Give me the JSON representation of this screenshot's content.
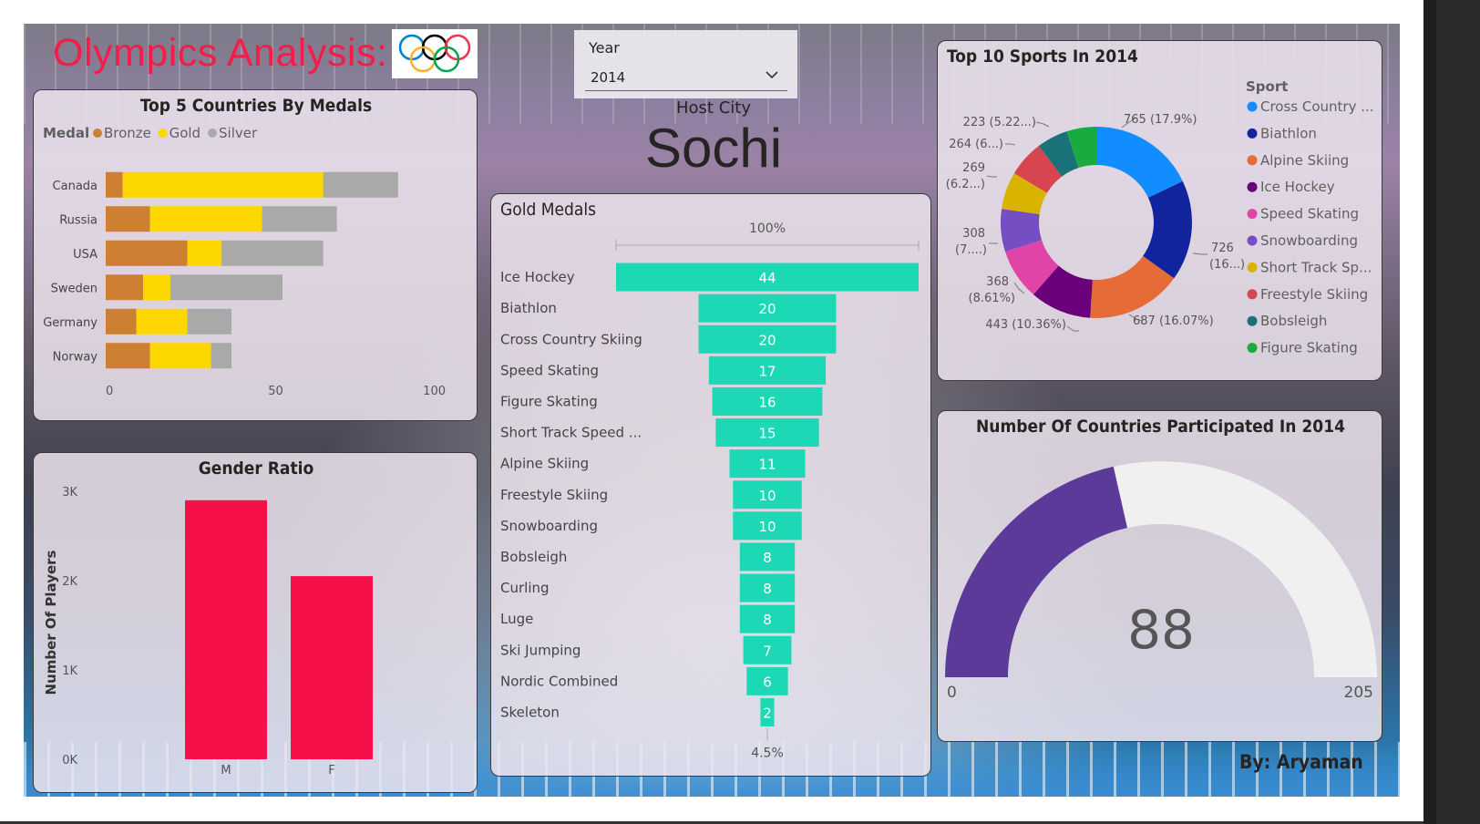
{
  "header": {
    "title": "Olympics Analysis:",
    "byline": "By: Aryaman"
  },
  "year_slicer": {
    "label": "Year",
    "value": "2014"
  },
  "host_city": {
    "label": "Host City",
    "value": "Sochi"
  },
  "colors": {
    "bronze": "#cd7f32",
    "gold": "#ffd700",
    "silver": "#a9a9a9",
    "gender_bar": "#f5104a",
    "funnel": "#1dd8b5",
    "gauge_fill": "#5b3a9a",
    "gauge_track": "#f0f0f0",
    "title_red": "#f41c49"
  },
  "icons": {
    "logo": "olympic-rings-icon",
    "dropdown": "chevron-down-icon"
  },
  "chart_data": [
    {
      "id": "top5",
      "type": "bar",
      "orientation": "horizontal",
      "stacked": true,
      "title": "Top 5 Countries By Medals",
      "legend_title": "Medal",
      "legend_position": "top-left",
      "categories": [
        "Canada",
        "Russia",
        "USA",
        "Sweden",
        "Germany",
        "Norway"
      ],
      "series": [
        {
          "name": "Bronze",
          "values": [
            5,
            13,
            24,
            11,
            9,
            13
          ]
        },
        {
          "name": "Gold",
          "values": [
            59,
            33,
            10,
            8,
            15,
            18
          ]
        },
        {
          "name": "Silver",
          "values": [
            22,
            22,
            30,
            33,
            13,
            6
          ]
        }
      ],
      "xlim": [
        0,
        100
      ],
      "xticks": [
        "0",
        "50",
        "100"
      ]
    },
    {
      "id": "gender",
      "type": "bar",
      "title": "Gender Ratio",
      "ylabel": "Number Of Players",
      "categories": [
        "M",
        "F"
      ],
      "values": [
        2900,
        2050
      ],
      "ylim": [
        0,
        3000
      ],
      "yticks": [
        "0K",
        "1K",
        "2K",
        "3K"
      ]
    },
    {
      "id": "gold",
      "type": "bar",
      "subtype": "funnel",
      "title": "Gold Medals",
      "top_label": "100%",
      "bottom_label": "4.5%",
      "categories": [
        "Ice Hockey",
        "Biathlon",
        "Cross Country Skiing",
        "Speed Skating",
        "Figure Skating",
        "Short Track Speed ...",
        "Alpine Skiing",
        "Freestyle Skiing",
        "Snowboarding",
        "Bobsleigh",
        "Curling",
        "Luge",
        "Ski Jumping",
        "Nordic Combined",
        "Skeleton"
      ],
      "values": [
        44,
        20,
        20,
        17,
        16,
        15,
        11,
        10,
        10,
        8,
        8,
        8,
        7,
        6,
        2
      ],
      "labels": [
        "44",
        "20",
        "20",
        "17",
        "16",
        "15",
        "11",
        "10",
        "10",
        "8",
        "8",
        "8",
        "7",
        "6",
        "2"
      ]
    },
    {
      "id": "sports",
      "type": "pie",
      "subtype": "donut",
      "title": "Top 10 Sports In 2014",
      "legend_title": "Sport",
      "legend_position": "right",
      "categories": [
        "Cross Country ...",
        "Biathlon",
        "Alpine Skiing",
        "Ice Hockey",
        "Speed Skating",
        "Snowboarding",
        "Short Track Sp...",
        "Freestyle Skiing",
        "Bobsleigh",
        "Figure Skating"
      ],
      "values": [
        765,
        726,
        687,
        443,
        368,
        308,
        269,
        264,
        223,
        214
      ],
      "colors": [
        "#118dff",
        "#12239e",
        "#e66c37",
        "#6b007b",
        "#e044a7",
        "#744ec2",
        "#d9b300",
        "#d64550",
        "#197278",
        "#1aab40"
      ],
      "data_labels": {
        "0": "765 (17.9%)",
        "1a": "726",
        "1b": "(16...)",
        "2": "687 (16.07%)",
        "3": "443 (10.36%)",
        "4a": "368",
        "4b": "(8.61%)",
        "5a": "308",
        "5b": "(7....)",
        "6a": "269",
        "6b": "(6.2...)",
        "7": "264 (6...)",
        "8": "223 (5.22...)"
      }
    },
    {
      "id": "gauge",
      "type": "gauge",
      "title": "Number Of Countries Participated In 2014",
      "value": 88,
      "value_label": "88",
      "min": 0,
      "max": 205,
      "min_label": "0",
      "max_label": "205"
    }
  ]
}
